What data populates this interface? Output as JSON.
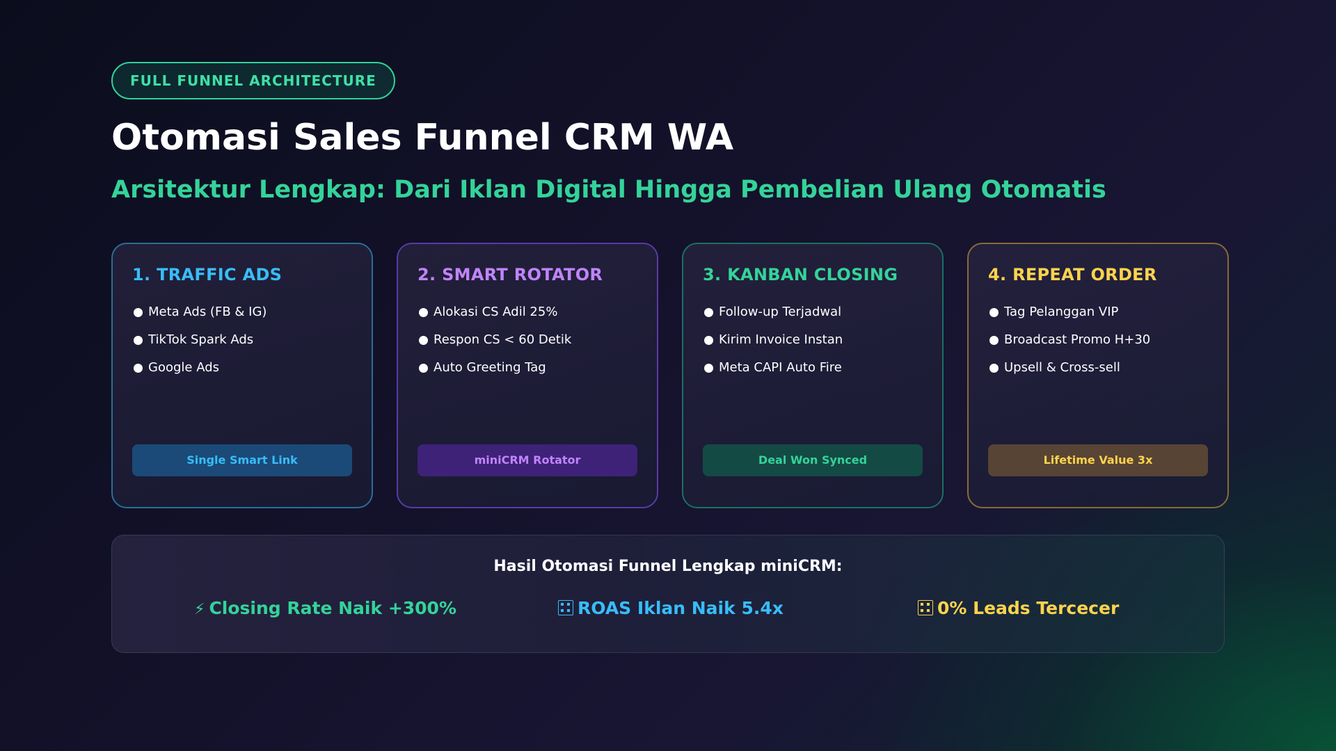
{
  "header": {
    "badge": "FULL FUNNEL ARCHITECTURE",
    "title": "Otomasi Sales Funnel CRM WA",
    "subtitle": "Arsitektur Lengkap: Dari Iklan Digital Hingga Pembelian Ulang Otomatis"
  },
  "cards": [
    {
      "title": "1. TRAFFIC ADS",
      "color": "#38bdf8",
      "border": "#2a6e96",
      "tag_bg": "#1b4a78",
      "items": [
        "Meta Ads (FB & IG)",
        "TikTok Spark Ads",
        "Google Ads"
      ],
      "tag": "Single Smart Link"
    },
    {
      "title": "2. SMART ROTATOR",
      "color": "#c084fc",
      "border": "#5b3aa6",
      "tag_bg": "#3e2278",
      "items": [
        "Alokasi CS Adil 25%",
        "Respon CS < 60 Detik",
        "Auto Greeting Tag"
      ],
      "tag": "miniCRM Rotator"
    },
    {
      "title": "3. KANBAN CLOSING",
      "color": "#34d399",
      "border": "#1e6e66",
      "tag_bg": "#144a44",
      "items": [
        "Follow-up Terjadwal",
        "Kirim Invoice Instan",
        "Meta CAPI Auto Fire"
      ],
      "tag": "Deal Won Synced"
    },
    {
      "title": "4. REPEAT ORDER",
      "color": "#fcd34d",
      "border": "#8a6a3a",
      "tag_bg": "#584434",
      "items": [
        "Tag Pelanggan VIP",
        "Broadcast Promo H+30",
        "Upsell & Cross-sell"
      ],
      "tag": "Lifetime Value 3x"
    }
  ],
  "results": {
    "title": "Hasil Otomasi Funnel Lengkap miniCRM:",
    "stats": [
      {
        "icon": "lightning-icon",
        "glyph": "⚡",
        "label": "Closing Rate Naik +300%",
        "color": "#34d399"
      },
      {
        "icon": "missing-glyph-icon",
        "label": "ROAS Iklan Naik 5.4x",
        "color": "#38bdf8"
      },
      {
        "icon": "missing-glyph-icon",
        "label": "0% Leads Tercecer",
        "color": "#fcd34d"
      }
    ]
  }
}
